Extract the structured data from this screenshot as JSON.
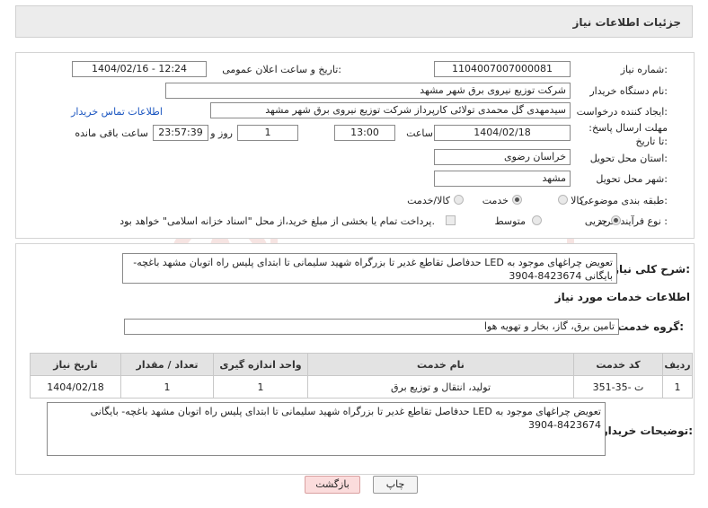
{
  "header": {
    "title": "جزئیات اطلاعات نیاز"
  },
  "form": {
    "need_number_label": "شماره نیاز:",
    "need_number": "1104007007000081",
    "announce_label": "تاریخ و ساعت اعلان عمومی:",
    "announce_value": "1404/02/16 - 12:24",
    "buyer_org_label": "نام دستگاه خریدار:",
    "buyer_org": "شرکت توزیع نیروی برق شهر مشهد",
    "creator_label": "ایجاد کننده درخواست:",
    "creator": "سیدمهدی  گل محمدی تولائی کارپرداز شرکت توزیع نیروی برق شهر مشهد",
    "contact_link": "اطلاعات تماس خریدار",
    "deadline_label": "مهلت ارسال پاسخ: تا تاریخ:",
    "deadline_date": "1404/02/18",
    "time_label": "ساعت",
    "deadline_time": "13:00",
    "days_count": "1",
    "days_label": "روز و",
    "remaining_time": "23:57:39",
    "remaining_label": "ساعت باقی مانده",
    "province_label": "استان محل تحویل:",
    "province": "خراسان رضوی",
    "city_label": "شهر محل تحویل:",
    "city": "مشهد",
    "category_label": "طبقه بندی موضوعی:",
    "category_options": [
      "کالا",
      "خدمت",
      "کالا/خدمت"
    ],
    "category_selected": "خدمت",
    "process_label": "نوع فرآیند خرید :",
    "process_options": [
      "جزیی",
      "متوسط"
    ],
    "process_selected": "جزیی",
    "payment_note": "پرداخت تمام یا بخشی از مبلغ خرید،از محل \"اسناد خزانه اسلامی\" خواهد بود."
  },
  "description": {
    "label": "شرح کلی نیاز:",
    "text": "تعویض چراغهای موجود به LED حدفاصل تقاطع غدیر تا بزرگراه شهید سلیمانی تا ابتدای پلیس راه اتوبان مشهد باغچه- بایگانی 8423674-3904"
  },
  "services": {
    "section_title": "اطلاعات خدمات مورد نیاز",
    "group_label": "گروه خدمت:",
    "group_value": "تامین برق، گاز، بخار و تهویه هوا",
    "columns": [
      "ردیف",
      "کد خدمت",
      "نام خدمت",
      "واحد اندازه گیری",
      "تعداد / مقدار",
      "تاریخ نیاز"
    ],
    "rows": [
      {
        "index": "1",
        "code": "ت -35-351",
        "name": "تولید، انتقال و توزیع برق",
        "unit": "1",
        "qty": "1",
        "date": "1404/02/18"
      }
    ]
  },
  "buyer_notes": {
    "label": "توضیحات خریدار:",
    "text": "تعویض چراغهای موجود به LED حدفاصل تقاطع غدیر تا بزرگراه شهید سلیمانی تا ابتدای پلیس راه اتوبان مشهد باغچه- بایگانی 8423674-3904"
  },
  "buttons": {
    "print": "چاپ",
    "back": "بازگشت"
  }
}
